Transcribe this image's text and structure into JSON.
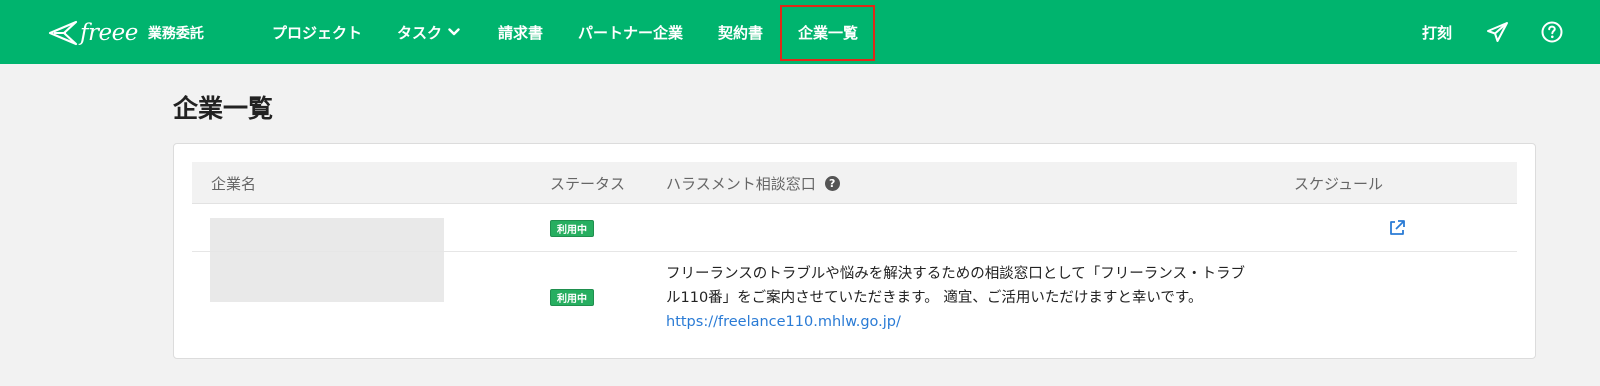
{
  "brand": {
    "logo_word": "freee",
    "product": "業務委託"
  },
  "nav": {
    "items": [
      {
        "label": "プロジェクト"
      },
      {
        "label": "タスク"
      },
      {
        "label": "請求書"
      },
      {
        "label": "パートナー企業"
      },
      {
        "label": "契約書"
      },
      {
        "label": "企業一覧"
      }
    ],
    "active": "企業一覧"
  },
  "header_right": {
    "punch_label": "打刻",
    "send_icon": "paper-plane-icon",
    "help_icon": "question-circle-icon"
  },
  "page": {
    "title": "企業一覧"
  },
  "table": {
    "columns": {
      "company": "企業名",
      "status": "ステータス",
      "harassment": "ハラスメント相談窓口",
      "schedule": "スケジュール"
    },
    "rows": [
      {
        "status": "利用中",
        "schedule_icon": "external-link-icon"
      },
      {
        "status": "利用中",
        "harassment_line1": "フリーランスのトラブルや悩みを解決するための相談窓口として「フリーランス・トラブ",
        "harassment_line2": "ル110番」をご案内させていただきます。 適宜、ご活用いただけますと幸いです。",
        "harassment_link": "https://freelance110.mhlw.go.jp/"
      }
    ]
  },
  "colors": {
    "brand_green": "#00b46e",
    "badge_green": "#27ae60",
    "link_blue": "#2a7bd5",
    "highlight_red": "#e02818"
  }
}
